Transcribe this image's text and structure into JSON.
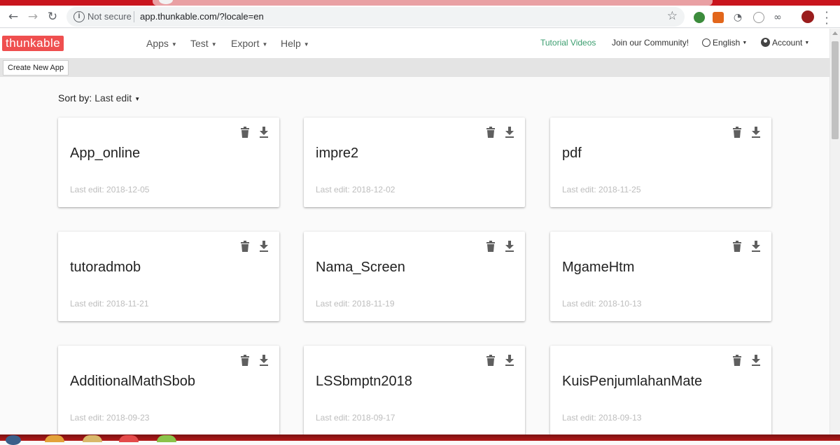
{
  "browser": {
    "security_label": "Not secure",
    "url": "app.thunkable.com/?locale=en"
  },
  "header": {
    "logo_text": "thunkable",
    "nav": [
      "Apps",
      "Test",
      "Export",
      "Help"
    ],
    "tutorial_link": "Tutorial Videos",
    "community_link": "Join our Community!",
    "language": "English",
    "account": "Account"
  },
  "actions": {
    "create_label": "Create New App"
  },
  "sort": {
    "label": "Sort by:",
    "value": "Last edit"
  },
  "apps": [
    {
      "name": "App_online",
      "last_edit": "Last edit: 2018-12-05"
    },
    {
      "name": "impre2",
      "last_edit": "Last edit: 2018-12-02"
    },
    {
      "name": "pdf",
      "last_edit": "Last edit: 2018-11-25"
    },
    {
      "name": "tutoradmob",
      "last_edit": "Last edit: 2018-11-21"
    },
    {
      "name": "Nama_Screen",
      "last_edit": "Last edit: 2018-11-19"
    },
    {
      "name": "MgameHtm",
      "last_edit": "Last edit: 2018-10-13"
    },
    {
      "name": "AdditionalMathSbob",
      "last_edit": "Last edit: 2018-09-23"
    },
    {
      "name": "LSSbmptn2018",
      "last_edit": "Last edit: 2018-09-17"
    },
    {
      "name": "KuisPenjumlahanMate",
      "last_edit": "Last edit: 2018-09-13"
    }
  ],
  "colors": {
    "brand": "#ef4f4f",
    "tutorial_link": "#3a9d6e",
    "taskbar": "#b31a1a"
  }
}
